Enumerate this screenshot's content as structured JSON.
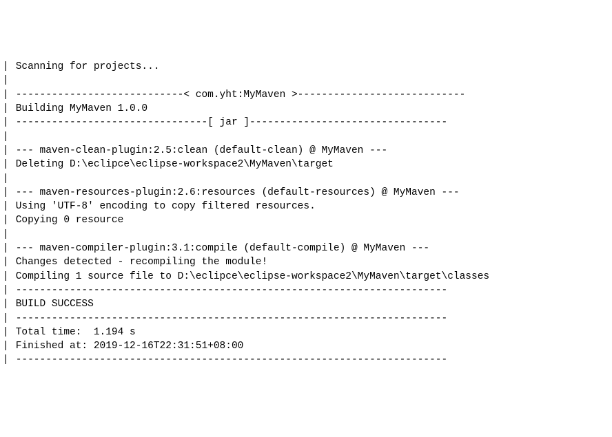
{
  "lines": [
    {
      "prefix": "|",
      "text": " Scanning for projects..."
    },
    {
      "prefix": "|",
      "text": " "
    },
    {
      "prefix": "|",
      "text": " ----------------------------< com.yht:MyMaven >----------------------------"
    },
    {
      "prefix": "|",
      "text": " Building MyMaven 1.0.0"
    },
    {
      "prefix": "|",
      "text": " --------------------------------[ jar ]---------------------------------"
    },
    {
      "prefix": "|",
      "text": " "
    },
    {
      "prefix": "|",
      "text": " --- maven-clean-plugin:2.5:clean (default-clean) @ MyMaven ---"
    },
    {
      "prefix": "|",
      "text": " Deleting D:\\eclipce\\eclipse-workspace2\\MyMaven\\target"
    },
    {
      "prefix": "|",
      "text": " "
    },
    {
      "prefix": "|",
      "text": " --- maven-resources-plugin:2.6:resources (default-resources) @ MyMaven ---"
    },
    {
      "prefix": "|",
      "text": " Using 'UTF-8' encoding to copy filtered resources."
    },
    {
      "prefix": "|",
      "text": " Copying 0 resource"
    },
    {
      "prefix": "|",
      "text": " "
    },
    {
      "prefix": "|",
      "text": " --- maven-compiler-plugin:3.1:compile (default-compile) @ MyMaven ---"
    },
    {
      "prefix": "|",
      "text": " Changes detected - recompiling the module!"
    },
    {
      "prefix": "|",
      "text": " Compiling 1 source file to D:\\eclipce\\eclipse-workspace2\\MyMaven\\target\\classes"
    },
    {
      "prefix": "|",
      "text": " ------------------------------------------------------------------------"
    },
    {
      "prefix": "|",
      "text": " BUILD SUCCESS"
    },
    {
      "prefix": "|",
      "text": " ------------------------------------------------------------------------"
    },
    {
      "prefix": "|",
      "text": " Total time:  1.194 s"
    },
    {
      "prefix": "|",
      "text": " Finished at: 2019-12-16T22:31:51+08:00"
    },
    {
      "prefix": "|",
      "text": " ------------------------------------------------------------------------"
    }
  ]
}
